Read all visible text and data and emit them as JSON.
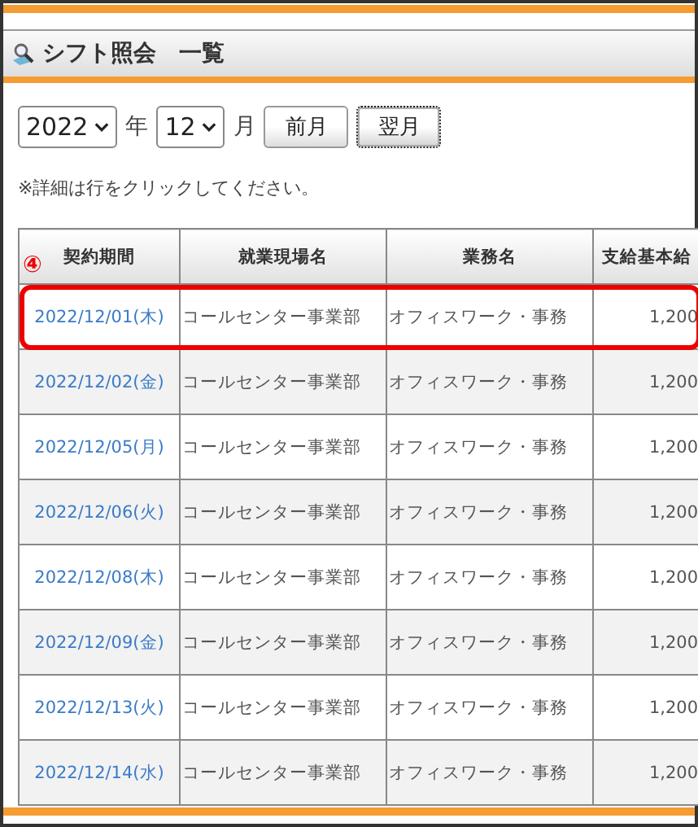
{
  "header": {
    "title": "シフト照会　一覧"
  },
  "filter": {
    "year": "2022",
    "year_unit": "年",
    "month": "12",
    "month_unit": "月",
    "buttons": [
      {
        "label": "前月",
        "focused": false
      },
      {
        "label": "翌月",
        "focused": true
      }
    ]
  },
  "note": "※詳細は行をクリックしてください。",
  "annotation": {
    "label": "④"
  },
  "table": {
    "columns": [
      "契約期間",
      "就業現場名",
      "業務名",
      "支給基本給"
    ],
    "rows": [
      {
        "date": "2022/12/01(木)",
        "site": "コールセンター事業部",
        "job": "オフィスワーク・事務",
        "pay": "1,200",
        "marked": true
      },
      {
        "date": "2022/12/02(金)",
        "site": "コールセンター事業部",
        "job": "オフィスワーク・事務",
        "pay": "1,200",
        "marked": false
      },
      {
        "date": "2022/12/05(月)",
        "site": "コールセンター事業部",
        "job": "オフィスワーク・事務",
        "pay": "1,200",
        "marked": false
      },
      {
        "date": "2022/12/06(火)",
        "site": "コールセンター事業部",
        "job": "オフィスワーク・事務",
        "pay": "1,200",
        "marked": false
      },
      {
        "date": "2022/12/08(木)",
        "site": "コールセンター事業部",
        "job": "オフィスワーク・事務",
        "pay": "1,200",
        "marked": false
      },
      {
        "date": "2022/12/09(金)",
        "site": "コールセンター事業部",
        "job": "オフィスワーク・事務",
        "pay": "1,200",
        "marked": false
      },
      {
        "date": "2022/12/13(火)",
        "site": "コールセンター事業部",
        "job": "オフィスワーク・事務",
        "pay": "1,200",
        "marked": false
      },
      {
        "date": "2022/12/14(水)",
        "site": "コールセンター事業部",
        "job": "オフィスワーク・事務",
        "pay": "1,200",
        "marked": false
      }
    ]
  }
}
